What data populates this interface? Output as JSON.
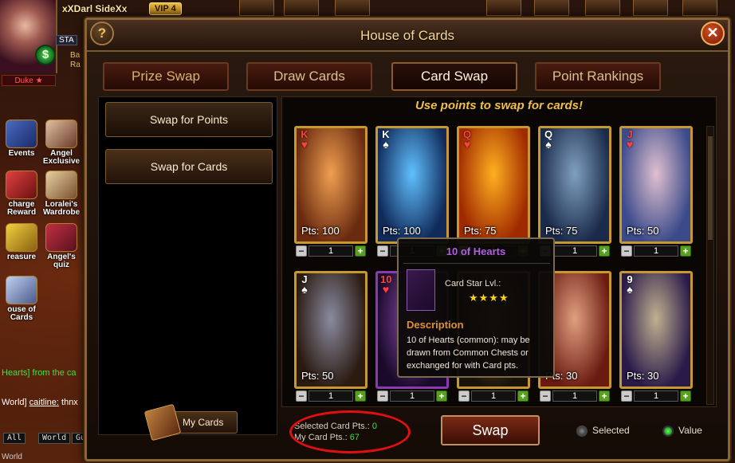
{
  "player": {
    "name": "xXDarl SideXx",
    "vip": "VIP 4",
    "sta": "STA",
    "gold_icon": "$",
    "rank_lines": [
      "Ba",
      "Ra"
    ],
    "title": "Duke ★"
  },
  "side_buttons": [
    {
      "label": "Events"
    },
    {
      "label": "Angel Exclusive"
    },
    {
      "label": "charge Reward"
    },
    {
      "label": "Loralei's Wardrobe"
    },
    {
      "label": "reasure"
    },
    {
      "label": "Angel's quiz"
    },
    {
      "label": "ouse of Cards"
    }
  ],
  "chat": {
    "line1": "Hearts] from the ca",
    "line2_prefix": "World]",
    "line2_user": "caitline:",
    "line2_text": "thnx",
    "tabs": [
      "All",
      "World",
      "Gu"
    ],
    "input_label": "World"
  },
  "dialog": {
    "title": "House of Cards",
    "help_icon": "?",
    "close_icon": "✕",
    "tabs": [
      "Prize Swap",
      "Draw Cards",
      "Card Swap",
      "Point Rankings"
    ],
    "active_tab": "Card Swap",
    "left_menu": [
      "Swap for Points",
      "Swap for Cards"
    ],
    "my_cards_label": "My Cards",
    "banner": "Use points to swap for cards!"
  },
  "cards": [
    {
      "rank": "K",
      "suit": "♥",
      "red": true,
      "pts": "Pts: 100",
      "qty": "1",
      "art": [
        "#f0a050",
        "#6a2a10"
      ]
    },
    {
      "rank": "K",
      "suit": "♠",
      "red": false,
      "pts": "Pts: 100",
      "qty": "1",
      "art": [
        "#60c0ff",
        "#102a5a"
      ]
    },
    {
      "rank": "Q",
      "suit": "♥",
      "red": true,
      "pts": "Pts: 75",
      "qty": "1",
      "art": [
        "#ffb020",
        "#a02a00"
      ]
    },
    {
      "rank": "Q",
      "suit": "♠",
      "red": false,
      "pts": "Pts: 75",
      "qty": "1",
      "art": [
        "#80a0c0",
        "#1a2a4a"
      ]
    },
    {
      "rank": "J",
      "suit": "♥",
      "red": true,
      "pts": "Pts: 50",
      "qty": "1",
      "art": [
        "#e0c0d0",
        "#3a4a8a"
      ]
    },
    {
      "rank": "J",
      "suit": "♠",
      "red": false,
      "pts": "Pts: 50",
      "qty": "1",
      "art": [
        "#8a8aa0",
        "#2a1a10"
      ]
    },
    {
      "rank": "10",
      "suit": "♥",
      "red": true,
      "pts": "",
      "qty": "1",
      "art": [
        "#8a4ab0",
        "#1a0a2a"
      ]
    },
    {
      "rank": "",
      "suit": "",
      "red": false,
      "pts": "",
      "qty": "1",
      "art": [
        "#6a5a3a",
        "#1a1208"
      ]
    },
    {
      "rank": "",
      "suit": "",
      "red": true,
      "pts": "Pts: 30",
      "qty": "1",
      "art": [
        "#e0a080",
        "#6a1a10"
      ]
    },
    {
      "rank": "9",
      "suit": "♠",
      "red": false,
      "pts": "Pts: 30",
      "qty": "1",
      "art": [
        "#c0b090",
        "#2a1a4a"
      ]
    }
  ],
  "tooltip": {
    "title": "10 of Hearts",
    "star_label": "Card Star Lvl.:",
    "stars": "★★★★",
    "desc_head": "Description",
    "desc": "10 of Hearts (common): may be drawn from Common Chests or exchanged for with Card pts."
  },
  "footer": {
    "selected_label": "Selected Card Pts.: ",
    "selected_value": "0",
    "my_label": "My Card Pts.: ",
    "my_value": "67",
    "swap_label": "Swap",
    "legend_selected": "Selected",
    "legend_value": "Value"
  },
  "colors": {
    "accent_gold": "#f4c040",
    "points_green": "#40e040",
    "highlight_red": "#e01010",
    "tooltip_title": "#b060e0"
  }
}
